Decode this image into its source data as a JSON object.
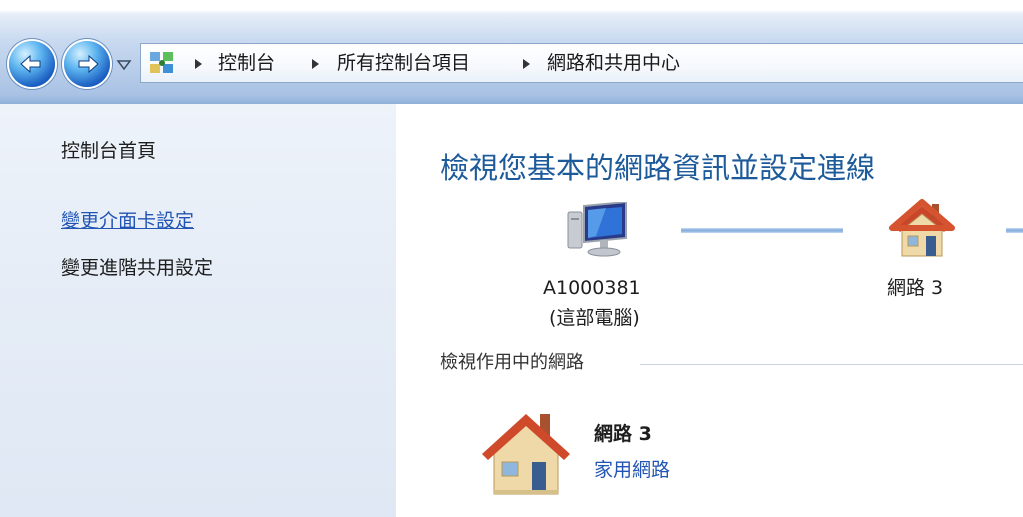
{
  "address_bar": {
    "breadcrumbs": [
      "控制台",
      "所有控制台項目",
      "網路和共用中心"
    ]
  },
  "left_pane": {
    "home": "控制台首頁",
    "links": [
      "變更介面卡設定",
      "變更進階共用設定"
    ]
  },
  "main": {
    "title": "檢視您基本的網路資訊並設定連線",
    "network_map": {
      "computer_name": "A1000381",
      "computer_caption": "(這部電腦)",
      "network_label": "網路 3"
    },
    "active_networks_heading": "檢視作用中的網路",
    "active_network": {
      "name": "網路 3",
      "type": "家用網路"
    }
  },
  "icons": {
    "back": "back-arrow-icon",
    "forward": "forward-arrow-icon",
    "control_panel": "control-panel-icon",
    "computer": "computer-icon",
    "home": "home-network-icon"
  },
  "colors": {
    "title_blue": "#1d5a9a",
    "link_blue": "#2255b3",
    "left_pane_bg": "#e6edf7"
  }
}
